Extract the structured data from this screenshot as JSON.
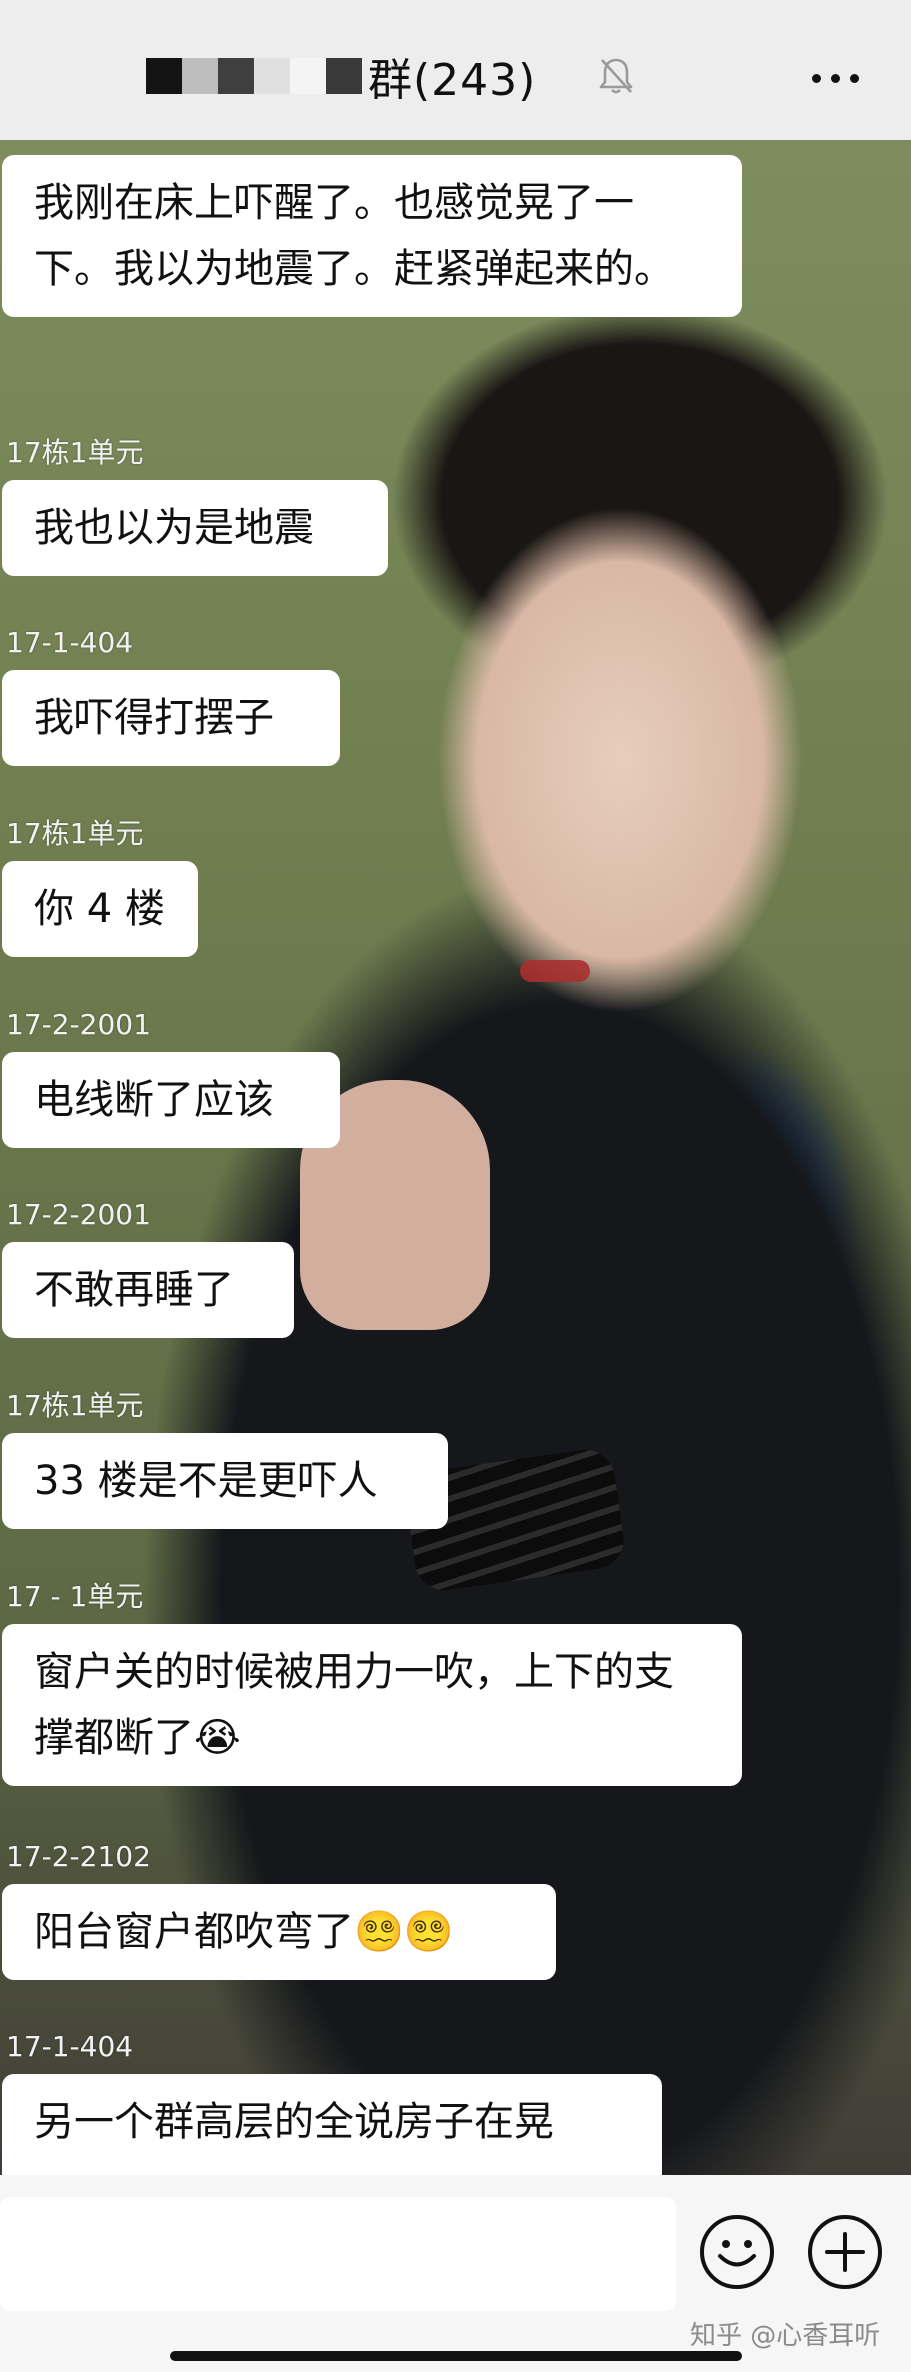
{
  "header": {
    "title": "群(243)",
    "mosaic_colors": [
      "#141414",
      "#bdbdbd",
      "#3f3f3f",
      "#e0e0e0",
      "#f4f4f4",
      "#3a3a3a"
    ],
    "mute_icon": "bell-slash-icon",
    "more_icon": "more-dots-icon"
  },
  "messages": [
    {
      "sender": "",
      "text": "我刚在床上吓醒了。也感觉晃了一下。我以为地震了。赶紧弹起来的。"
    },
    {
      "sender": "17栋1单元",
      "text": "我也以为是地震"
    },
    {
      "sender": "17-1-404",
      "text": "我吓得打摆子"
    },
    {
      "sender": "17栋1单元",
      "text": "你 4 楼"
    },
    {
      "sender": "17-2-2001",
      "text": "电线断了应该"
    },
    {
      "sender": "17-2-2001",
      "text": "不敢再睡了"
    },
    {
      "sender": "17栋1单元",
      "text": "33 楼是不是更吓人"
    },
    {
      "sender": "17 - 1单元",
      "text": "窗户关的时候被用力一吹，上下的支撑都断了😭"
    },
    {
      "sender": "17-2-2102",
      "text": "阳台窗户都吹弯了😵‍💫😵‍💫"
    },
    {
      "sender": "17-1-404",
      "text": "另一个群高层的全说房子在晃"
    }
  ],
  "input": {
    "placeholder": "",
    "emoji_icon": "smiley-icon",
    "plus_icon": "plus-circle-icon"
  },
  "watermark": "知乎 @心香耳听",
  "colors": {
    "header_bg": "#ededed",
    "bubble_bg": "#ffffff",
    "sender_text": "#f2f2f2",
    "bottom_bar_bg": "#f6f6f6"
  }
}
